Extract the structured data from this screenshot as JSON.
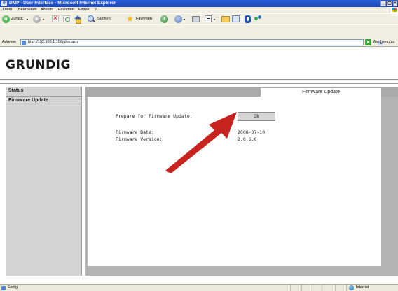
{
  "window": {
    "title": "DMP - User Interface - Microsoft Internet Explorer",
    "controls": {
      "minimize": "_",
      "maximize": "▢",
      "close": "×"
    }
  },
  "menubar": {
    "items": [
      "Datei",
      "Bearbeiten",
      "Ansicht",
      "Favoriten",
      "Extras",
      "?"
    ]
  },
  "toolbar": {
    "back_label": "Zurück",
    "search_label": "Suchen",
    "favorites_label": "Favoriten",
    "dropdown_glyph": "▾"
  },
  "address": {
    "label": "Adresse",
    "url": "http://192.168.1.10/index.asp",
    "go_label": "Wechseln zu"
  },
  "page": {
    "logo": "GRUNDIG",
    "sidebar": [
      "Status",
      "Firmware Update"
    ],
    "tab_label": "Firmware Update",
    "prepare_label": "Prepare for Firmware Update:",
    "ok_label": "Ok",
    "fw_date_label": "Firmware Date:",
    "fw_date_value": "2008-07-10",
    "fw_version_label": "Firmware Version:",
    "fw_version_value": "2.0.6.0"
  },
  "statusbar": {
    "text": "Fertig",
    "zone": "Internet"
  },
  "colors": {
    "title_bar": "#1c48b8",
    "sidebar_bg": "#d4d4d4",
    "frame_bg": "#b3b3b3",
    "arrow": "#c8231f"
  }
}
